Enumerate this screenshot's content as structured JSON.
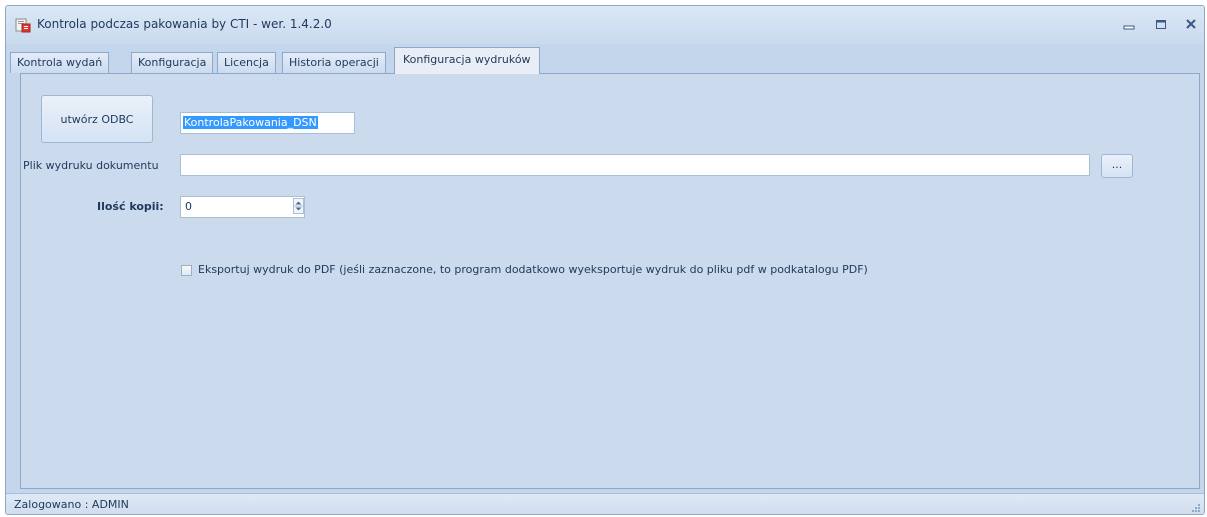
{
  "window": {
    "title": "Kontrola podczas pakowania by CTI -  wer. 1.4.2.0",
    "icon": "app-document-icon"
  },
  "tabs": [
    {
      "label": "Kontrola wydań",
      "active": false
    },
    {
      "label": "Konfiguracja",
      "active": false
    },
    {
      "label": "Licencja",
      "active": false
    },
    {
      "label": "Historia operacji",
      "active": false
    },
    {
      "label": "Konfiguracja wydruków",
      "active": true
    }
  ],
  "form": {
    "odbc_button_label": "utwórz ODBC",
    "dsn_value": "KontrolaPakowania_DSN",
    "file_label": "Plik wydruku dokumentu",
    "file_value": "",
    "browse_label": "...",
    "copies_label": "Ilość kopii:",
    "copies_value": "0",
    "export_pdf_checked": false,
    "export_pdf_label": "Eksportuj wydruk do PDF (jeśli zaznaczone, to program dodatkowo wyeksportuje wydruk do pliku pdf w podkatalogu PDF)"
  },
  "status": {
    "text": "Zalogowano : ADMIN"
  },
  "colors": {
    "accent": "#3399ff",
    "panel": "#ccdaed",
    "frame": "#c4d6ec",
    "text": "#1e395b"
  }
}
